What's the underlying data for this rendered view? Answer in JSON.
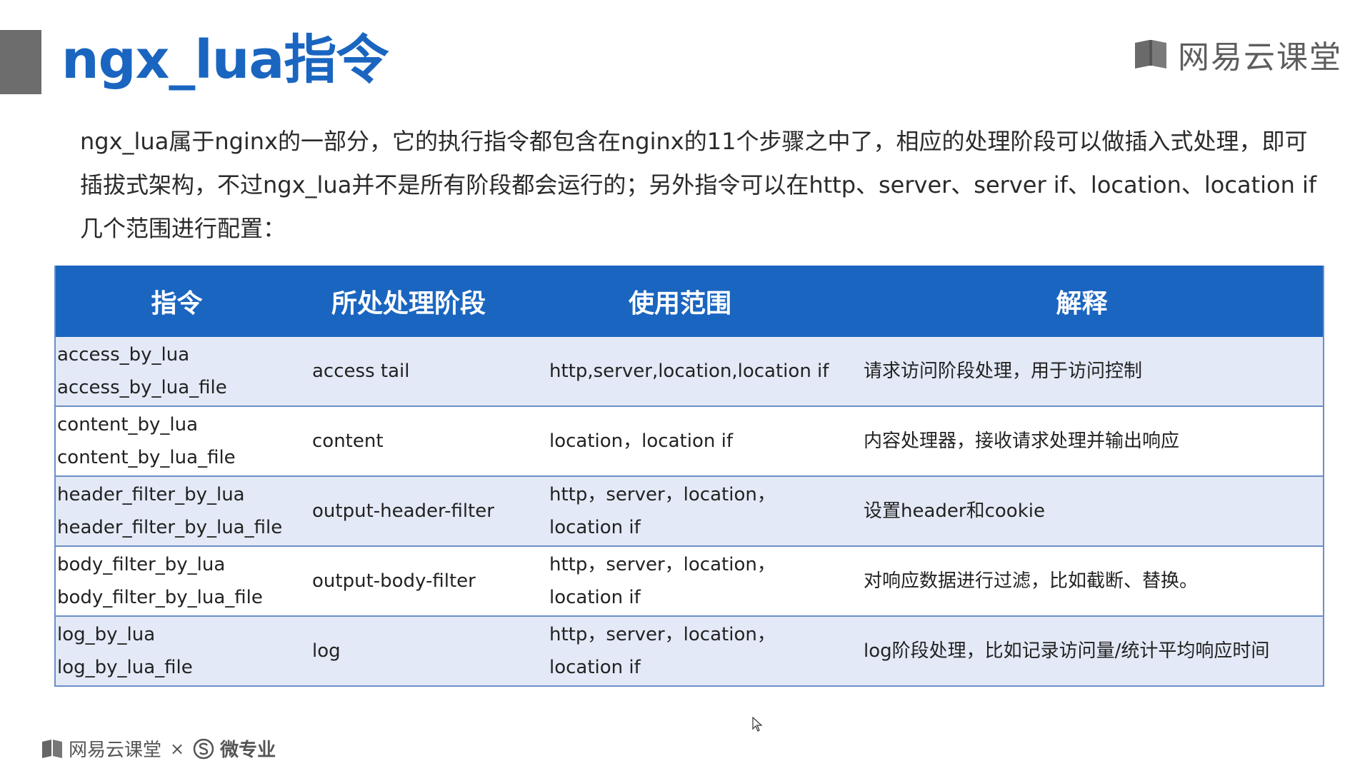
{
  "title": "ngx_lua指令",
  "brand": {
    "name": "网易云课堂",
    "footer_name": "网易云课堂",
    "footer_separator": "×",
    "footer_partner": "微专业",
    "logo_icon": "book-icon",
    "partner_icon": "s-circle-icon"
  },
  "intro": "ngx_lua属于nginx的一部分，它的执行指令都包含在nginx的11个步骤之中了，相应的处理阶段可以做插入式处理，即可插拔式架构，不过ngx_lua并不是所有阶段都会运行的；另外指令可以在http、server、server if、location、location if几个范围进行配置：",
  "colors": {
    "accent": "#1a65c0",
    "row_alt": "#e3e9f6",
    "side_bar": "#6d6d6d"
  },
  "table": {
    "headers": [
      "指令",
      "所处处理阶段",
      "使用范围",
      "解释"
    ],
    "rows": [
      {
        "directives": [
          "access_by_lua",
          "access_by_lua_file"
        ],
        "stage": "access tail",
        "scope": "http,server,location,location if",
        "desc": "请求访问阶段处理，用于访问控制"
      },
      {
        "directives": [
          "content_by_lua",
          "content_by_lua_file"
        ],
        "stage": "content",
        "scope": "location，location if",
        "desc": "内容处理器，接收请求处理并输出响应"
      },
      {
        "directives": [
          "header_filter_by_lua",
          "header_filter_by_lua_file"
        ],
        "stage": "output-header-filter",
        "scope": "http，server，location，location if",
        "desc": "设置header和cookie"
      },
      {
        "directives": [
          "body_filter_by_lua",
          "body_filter_by_lua_file"
        ],
        "stage": "output-body-filter",
        "scope": "http，server，location，location if",
        "desc": "对响应数据进行过滤，比如截断、替换。"
      },
      {
        "directives": [
          "log_by_lua",
          "log_by_lua_file"
        ],
        "stage": "log",
        "scope": "http，server，location，location if",
        "desc": "log阶段处理，比如记录访问量/统计平均响应时间"
      }
    ]
  }
}
